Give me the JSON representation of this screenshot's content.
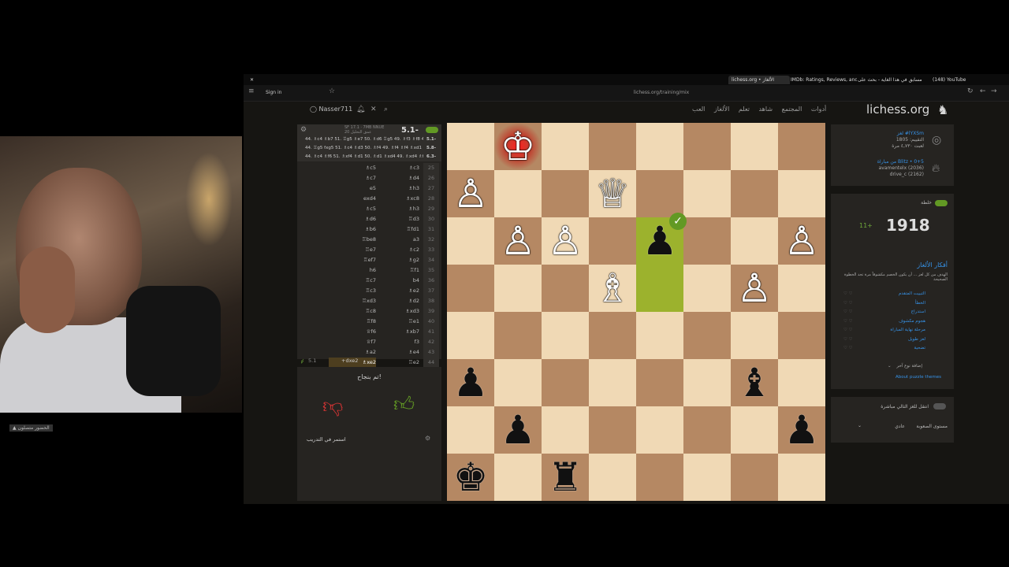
{
  "browser": {
    "tabs": [
      "lichess.org • الألغاز",
      "IMDb: Ratings, Reviews, and W",
      "مسابق في هذا الغاية - بحث على",
      "(148) YouTube"
    ],
    "url": "lichess.org/training/mix",
    "signin": "Sign in"
  },
  "header": {
    "logo": "lichess.org",
    "nav": [
      "أدوات",
      "المجتمع",
      "شاهد",
      "تعلم",
      "الألغاز",
      "العب"
    ],
    "username": "Nasser711"
  },
  "engine": {
    "eval": "5.1-",
    "info": "SF 17.1 · 7MB NNUE",
    "depth": "عمق التحليل 20",
    "lines": [
      {
        "eval": "5.1-",
        "text": "44. ♗c4 ♗b7 51. ♖g5 ♗e7 50. ♗d6 ♖g5 49. ♗f3 ♗f8 48. ♗d4 ♖g4"
      },
      {
        "eval": "5.8-",
        "text": "44. ♖g5 fxg5 51. ♗c4 ♗d3 50. ♗f4 49. ♗f4 ♗f4 ♗xd1 ♗xd1 48."
      },
      {
        "eval": "6.3-",
        "text": "44. ♗c4 ♗f6 51. ♗xf4 ♗d1 50. ♗d1 ♗xd4 49. ♗xd4 ♗f6 48. ♖3"
      }
    ]
  },
  "moves": [
    {
      "n": "25",
      "w": "♗c5",
      "b": "♗c3"
    },
    {
      "n": "26",
      "w": "♗c7",
      "b": "♗d4"
    },
    {
      "n": "27",
      "w": "e5",
      "b": "♗h3"
    },
    {
      "n": "28",
      "w": "exd4",
      "b": "♗xc8"
    },
    {
      "n": "29",
      "w": "♗c5",
      "b": "♗h3"
    },
    {
      "n": "30",
      "w": "♗d6",
      "b": "♖d3"
    },
    {
      "n": "31",
      "w": "♗b6",
      "b": "♖fd1"
    },
    {
      "n": "32",
      "w": "♖be8",
      "b": "a3"
    },
    {
      "n": "33",
      "w": "♖e7",
      "b": "♗c2"
    },
    {
      "n": "34",
      "w": "♖ef7",
      "b": "♗g2"
    },
    {
      "n": "35",
      "w": "h6",
      "b": "♖f1"
    },
    {
      "n": "36",
      "w": "♖c7",
      "b": "b4"
    },
    {
      "n": "37",
      "w": "♖c3",
      "b": "♗e2"
    },
    {
      "n": "38",
      "w": "♖xd3",
      "b": "♗d2"
    },
    {
      "n": "39",
      "w": "♖c8",
      "b": "♗xd3"
    },
    {
      "n": "40",
      "w": "♖f8",
      "b": "♖e1"
    },
    {
      "n": "41",
      "w": "♕f6",
      "b": "♗xb7"
    },
    {
      "n": "42",
      "w": "♕f7",
      "b": "f3"
    },
    {
      "n": "43",
      "w": "♗a2",
      "b": "♗e4"
    },
    {
      "n": "44",
      "w": "♗xe2",
      "b": "♖e2"
    },
    {
      "n": "45",
      "w": "+d3",
      "b": "♗xe2"
    },
    {
      "n": "",
      "w": "5.0-",
      "b": "♗f1"
    },
    {
      "n": "44",
      "w": "",
      "b": "♗f2"
    }
  ],
  "solution_line": {
    "eval": "5.1",
    "move": "+dxe2"
  },
  "success": {
    "text": "تم بنجاح!",
    "continue": "استمر في التدريب"
  },
  "puzzle": {
    "id": "لغز #lYXSm",
    "rating": "التقييم: 1805",
    "plays": "لعبت ٤,٧٣٠ مرة",
    "from_game": "من مباراة Blitz • 0+5",
    "player1": "avamentelx (2036)",
    "player2": "drive_c (2162)"
  },
  "user_rating": {
    "label": "خلطة",
    "value": "1918",
    "diff": "11+"
  },
  "themes": {
    "title": "أفكار الألغاز",
    "desc": "الهدف من كل لغز ... أن يكون الخصم مكشوفاً مرة تجد الخطوة الصحيحة",
    "items": [
      "التبييت المتقدم",
      "الخطأ",
      "استدراج",
      "هجوم مكشوف",
      "مرحلة نهاية المباراة",
      "لغز طويل",
      "تضحية"
    ],
    "add": "إضافة نوع آخر",
    "about": "About puzzle themes"
  },
  "settings": {
    "auto_next": "انتقل للغز التالي مباشرة",
    "difficulty_label": "مستوى الصعوبة",
    "difficulty_value": "عادي"
  },
  "board": {
    "pieces": [
      {
        "sq": "b8",
        "p": "♔",
        "c": "w"
      },
      {
        "sq": "a7",
        "p": "♙",
        "c": "w"
      },
      {
        "sq": "d7",
        "p": "♕",
        "c": "w"
      },
      {
        "sq": "b6",
        "p": "♙",
        "c": "w"
      },
      {
        "sq": "c6",
        "p": "♙",
        "c": "w"
      },
      {
        "sq": "e6",
        "p": "♟",
        "c": "b"
      },
      {
        "sq": "h6",
        "p": "♙",
        "c": "w"
      },
      {
        "sq": "d5",
        "p": "♗",
        "c": "w"
      },
      {
        "sq": "g5",
        "p": "♙",
        "c": "w"
      },
      {
        "sq": "a3",
        "p": "♟",
        "c": "b"
      },
      {
        "sq": "g3",
        "p": "♝",
        "c": "b"
      },
      {
        "sq": "b2",
        "p": "♟",
        "c": "b"
      },
      {
        "sq": "h2",
        "p": "♟",
        "c": "b"
      },
      {
        "sq": "a1",
        "p": "♚",
        "c": "b"
      },
      {
        "sq": "c1",
        "p": "♜",
        "c": "b"
      }
    ],
    "highlight": [
      "e6",
      "e5"
    ],
    "check": "b8",
    "light": "#f0d9b5",
    "dark": "#b58863"
  },
  "stream": {
    "label": "الحضور متصلون"
  }
}
